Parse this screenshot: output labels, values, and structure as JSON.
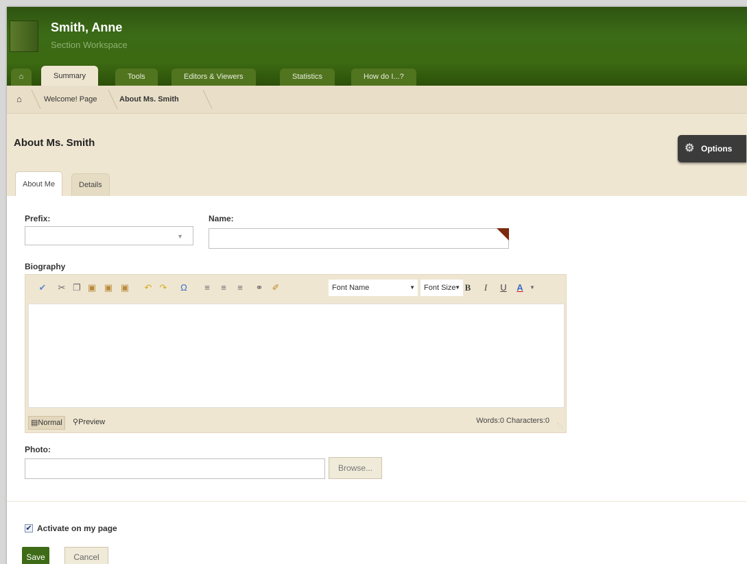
{
  "header": {
    "user_name": "Smith, Anne",
    "workspace": "Section Workspace"
  },
  "tabs": [
    {
      "label": "Summary"
    },
    {
      "label": "Tools"
    },
    {
      "label": "Editors & Viewers"
    },
    {
      "label": "Statistics"
    },
    {
      "label": "How do I...?"
    }
  ],
  "breadcrumb": {
    "items": [
      "Welcome! Page",
      "About Ms. Smith"
    ]
  },
  "page": {
    "title": "About Ms. Smith",
    "options_label": "Options"
  },
  "subtabs": [
    "About Me",
    "Details"
  ],
  "form": {
    "prefix_label": "Prefix:",
    "name_label": "Name:",
    "biography_label": "Biography",
    "photo_label": "Photo:",
    "browse_label": "Browse...",
    "activate_label": "Activate on my page",
    "activate_checked": true,
    "save_label": "Save",
    "cancel_label": "Cancel"
  },
  "editor": {
    "font_name": "Font Name",
    "font_size": "Font Size",
    "mode_normal": "Normal",
    "mode_preview": "Preview",
    "counts": "Words:0 Characters:0"
  }
}
